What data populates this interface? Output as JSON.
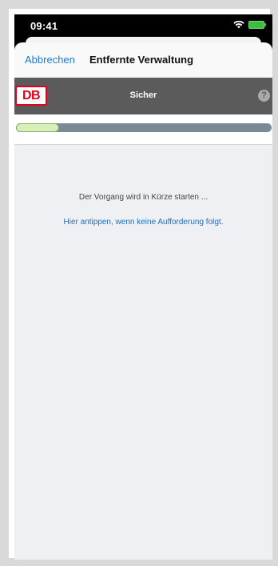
{
  "status_bar": {
    "time": "09:41",
    "wifi_icon": "wifi-icon",
    "battery_icon": "battery-icon",
    "battery_color": "#3bbf3b"
  },
  "nav": {
    "cancel_label": "Abbrechen",
    "title": "Entfernte Verwaltung",
    "link_color": "#1a7ad4"
  },
  "app_bar": {
    "logo_text": "DB",
    "logo_color": "#e2001a",
    "title": "Sicher",
    "help_icon": "help-icon",
    "help_glyph": "?",
    "bar_color": "#5b5b5b"
  },
  "progress": {
    "fraction": 0.17,
    "fill_color": "#d8efb9",
    "track_color": "#7b8b96"
  },
  "content": {
    "message": "Der Vorgang wird in Kürze starten ...",
    "tap_link": "Hier antippen, wenn keine Aufforderung folgt."
  }
}
